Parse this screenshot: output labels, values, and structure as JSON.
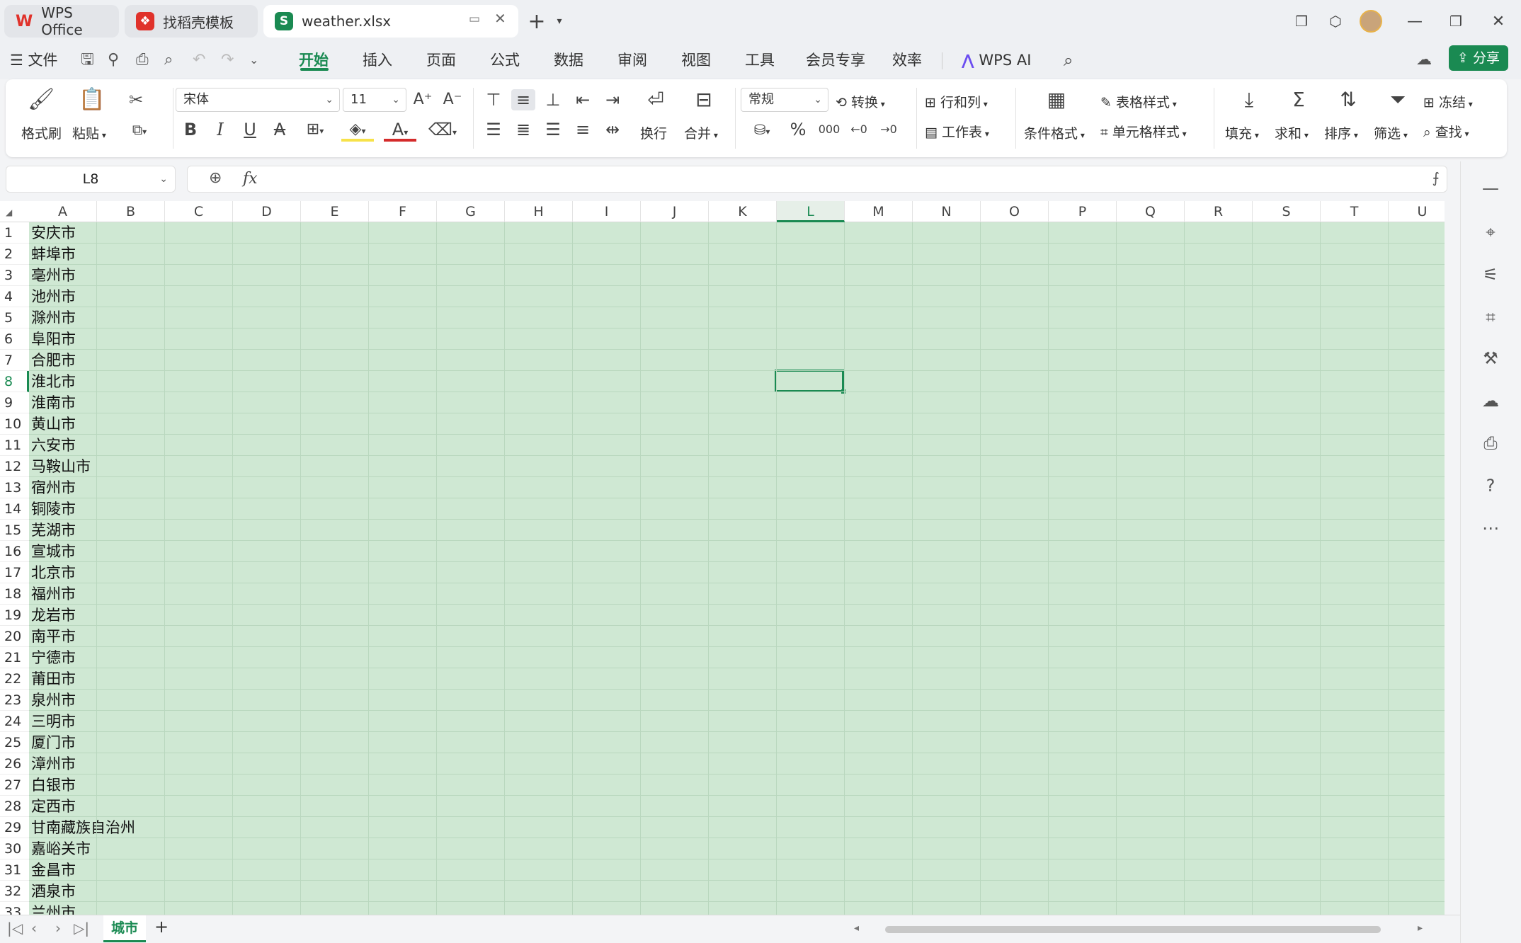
{
  "tabs": [
    {
      "label": "WPS Office",
      "icon": "wps-logo-icon",
      "active": false
    },
    {
      "label": "找稻壳模板",
      "icon": "docer-icon",
      "active": false
    },
    {
      "label": "weather.xlsx",
      "icon": "spreadsheet-icon",
      "active": true
    }
  ],
  "menu": {
    "file": "文件",
    "items": [
      "开始",
      "插入",
      "页面",
      "公式",
      "数据",
      "审阅",
      "视图",
      "工具",
      "会员专享",
      "效率"
    ],
    "active": "开始",
    "wps_ai": "WPS AI",
    "share": "分享"
  },
  "ribbon": {
    "format_painter": "格式刷",
    "paste": "粘贴",
    "font_name": "宋体",
    "font_size": "11",
    "wrap": "换行",
    "merge": "合并",
    "number_format": "常规",
    "convert": "转换",
    "row_col": "行和列",
    "worksheet": "工作表",
    "cond_format": "条件格式",
    "table_style": "表格样式",
    "cell_style": "单元格样式",
    "fill": "填充",
    "sum": "求和",
    "sort": "排序",
    "filter": "筛选",
    "freeze": "冻结",
    "find": "查找"
  },
  "formula_bar": {
    "name_box": "L8",
    "fx": "fx",
    "value": ""
  },
  "columns": [
    "A",
    "B",
    "C",
    "D",
    "E",
    "F",
    "G",
    "H",
    "I",
    "J",
    "K",
    "L",
    "M",
    "N",
    "O",
    "P",
    "Q",
    "R",
    "S",
    "T",
    "U"
  ],
  "active_column": "L",
  "active_row": 8,
  "rows": [
    "安庆市",
    "蚌埠市",
    "亳州市",
    "池州市",
    "滁州市",
    "阜阳市",
    "合肥市",
    "淮北市",
    "淮南市",
    "黄山市",
    "六安市",
    "马鞍山市",
    "宿州市",
    "铜陵市",
    "芜湖市",
    "宣城市",
    "北京市",
    "福州市",
    "龙岩市",
    "南平市",
    "宁德市",
    "莆田市",
    "泉州市",
    "三明市",
    "厦门市",
    "漳州市",
    "白银市",
    "定西市",
    "甘南藏族自治州",
    "嘉峪关市",
    "金昌市",
    "酒泉市",
    "兰州市"
  ],
  "sheet_tab": "城市",
  "colors": {
    "accent": "#1a8a52",
    "cell_bg": "#cfe8d3",
    "wps_red": "#e0322b"
  }
}
